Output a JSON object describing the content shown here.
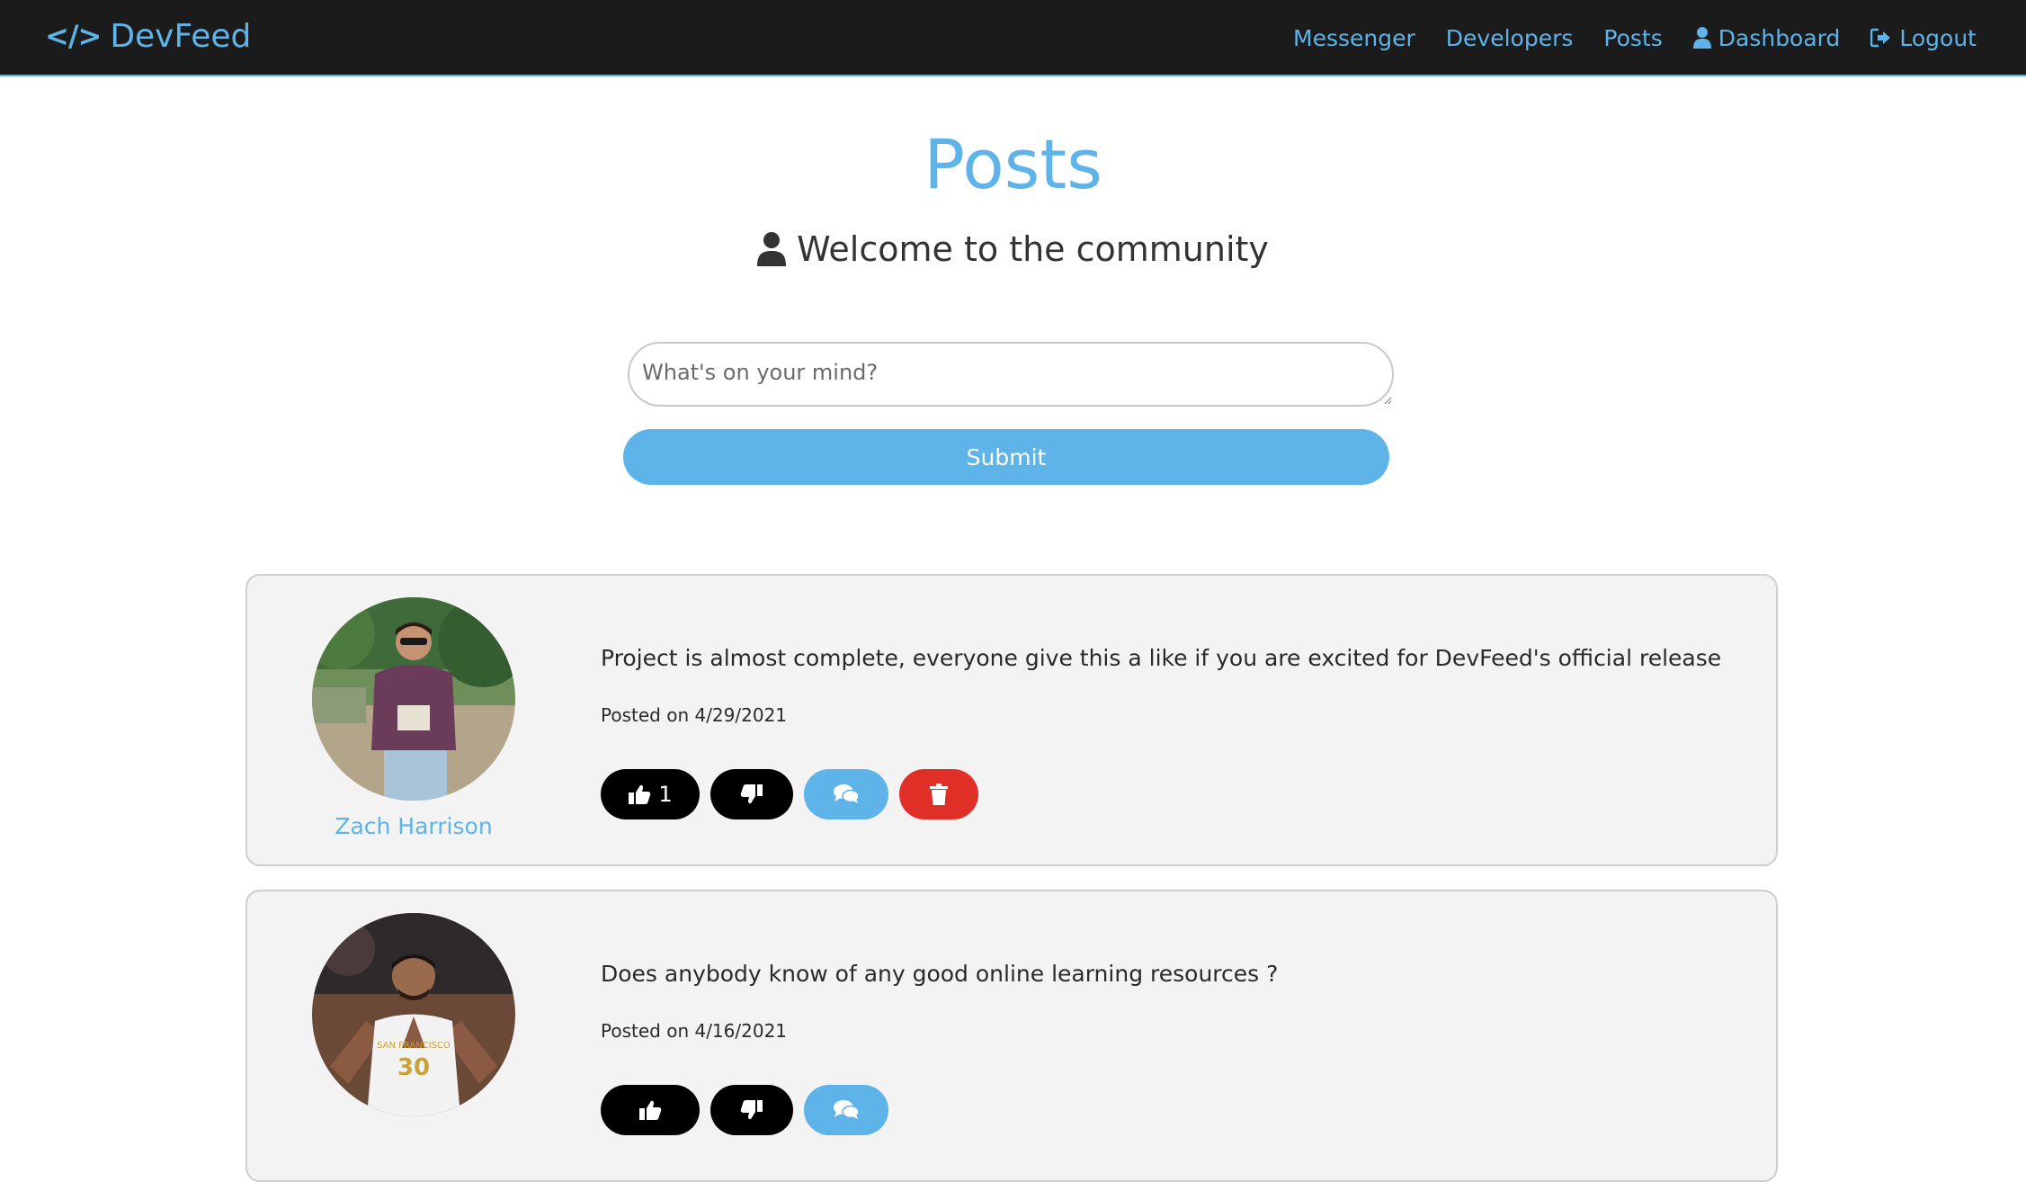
{
  "navbar": {
    "brand": "DevFeed",
    "brand_icon": "code-icon",
    "links": [
      {
        "label": "Messenger"
      },
      {
        "label": "Developers"
      },
      {
        "label": "Posts"
      },
      {
        "label": "Dashboard",
        "icon": "user-icon"
      },
      {
        "label": "Logout",
        "icon": "sign-out-icon"
      }
    ],
    "bg_color": "#1b1b1b",
    "accent_color": "#5eb3e8"
  },
  "header": {
    "title": "Posts",
    "subtitle": "Welcome to the community",
    "subtitle_icon": "user-icon"
  },
  "form": {
    "placeholder": "What's on your mind?",
    "value": "",
    "submit_label": "Submit"
  },
  "posts": [
    {
      "author": "Zach Harrison",
      "text": "Project is almost complete, everyone give this a like if you are excited for DevFeed's official release",
      "date": "Posted on 4/29/2021",
      "likes": "1",
      "actions": [
        "like-icon",
        "dislike-icon",
        "comments-icon",
        "trash-icon"
      ]
    },
    {
      "author": "",
      "text": "Does anybody know of any good online learning resources ?",
      "date": "Posted on 4/16/2021",
      "likes": "",
      "actions": [
        "like-icon",
        "dislike-icon",
        "comments-icon"
      ]
    }
  ],
  "colors": {
    "like_button": "#000000",
    "comment_button": "#5eb3e8",
    "delete_button": "#e02f26",
    "card_bg": "#f3f3f3"
  }
}
